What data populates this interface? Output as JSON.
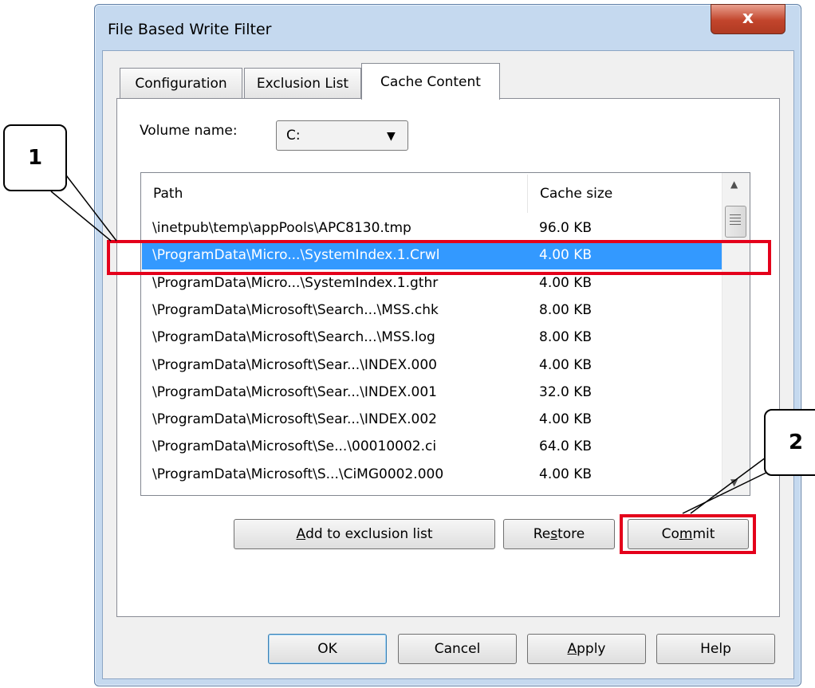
{
  "window": {
    "title": "File Based Write Filter",
    "close_glyph": "x"
  },
  "tabs": [
    {
      "label": "Configuration",
      "active": false
    },
    {
      "label": "Exclusion List",
      "active": false
    },
    {
      "label": "Cache Content",
      "active": true
    }
  ],
  "volume": {
    "label": "Volume name:",
    "value": "C:"
  },
  "list": {
    "columns": [
      "Path",
      "Cache size"
    ],
    "rows": [
      {
        "path": "\\inetpub\\temp\\appPools\\APC8130.tmp",
        "size": "96.0 KB"
      },
      {
        "path": "\\ProgramData\\Micro...\\SystemIndex.1.Crwl",
        "size": "4.00 KB",
        "selected": true
      },
      {
        "path": "\\ProgramData\\Micro...\\SystemIndex.1.gthr",
        "size": "4.00 KB"
      },
      {
        "path": "\\ProgramData\\Microsoft\\Search...\\MSS.chk",
        "size": "8.00 KB"
      },
      {
        "path": "\\ProgramData\\Microsoft\\Search...\\MSS.log",
        "size": "8.00 KB"
      },
      {
        "path": "\\ProgramData\\Microsoft\\Sear...\\INDEX.000",
        "size": "4.00 KB"
      },
      {
        "path": "\\ProgramData\\Microsoft\\Sear...\\INDEX.001",
        "size": "32.0 KB"
      },
      {
        "path": "\\ProgramData\\Microsoft\\Sear...\\INDEX.002",
        "size": "4.00 KB"
      },
      {
        "path": "\\ProgramData\\Microsoft\\Se...\\00010002.ci",
        "size": "64.0 KB"
      },
      {
        "path": "\\ProgramData\\Microsoft\\S...\\CiMG0002.000",
        "size": "4.00 KB"
      }
    ]
  },
  "actions": {
    "add_prefix": "",
    "add_u": "A",
    "add_rest": "dd to exclusion list",
    "restore_prefix": "Re",
    "restore_u": "s",
    "restore_rest": "tore",
    "commit_prefix": "Co",
    "commit_u": "m",
    "commit_rest": "mit"
  },
  "footer": {
    "ok": "OK",
    "cancel": "Cancel",
    "apply_u": "A",
    "apply_rest": "pply",
    "help": "Help"
  },
  "annotations": {
    "callout_1": "1",
    "callout_2": "2"
  },
  "colors": {
    "selection": "#3399ff",
    "highlight": "#e4001b"
  }
}
